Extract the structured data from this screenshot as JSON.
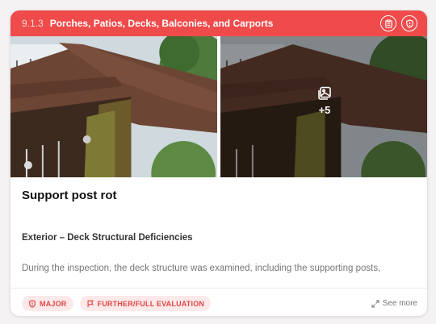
{
  "section": {
    "number": "9.1.3",
    "title": "Porches, Patios, Decks, Balconies, and Carports"
  },
  "header_icons": [
    "clipboard-icon",
    "shield-alert-icon"
  ],
  "photos": {
    "more_count": "+5"
  },
  "finding": {
    "title": "Support post rot",
    "category": "Exterior – Deck Structural Deficiencies",
    "description": "During the inspection, the deck structure was examined, including the supporting posts,"
  },
  "badges": [
    {
      "label": "MAJOR",
      "icon": "shield-alert-icon"
    },
    {
      "label": "FURTHER/FULL EVALUATION",
      "icon": "flag-icon"
    }
  ],
  "see_more_label": "See more",
  "colors": {
    "header": "#ef4b4b",
    "badge_bg": "#fde9e9",
    "badge_text": "#e24646"
  }
}
